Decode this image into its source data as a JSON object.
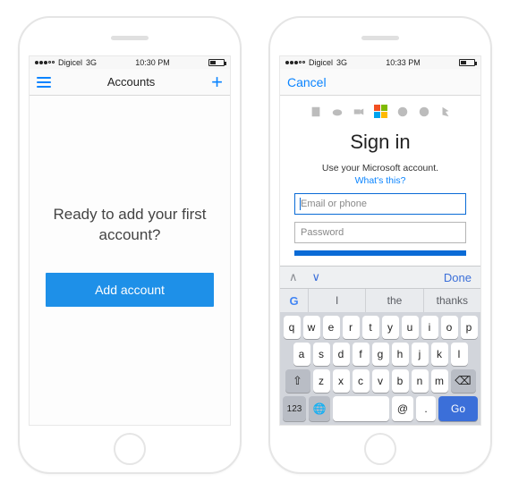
{
  "phone1": {
    "status": {
      "carrier": "Digicel",
      "network": "3G",
      "time": "10:30 PM"
    },
    "nav": {
      "title": "Accounts"
    },
    "body": {
      "prompt": "Ready to add your first account?",
      "add_button": "Add account"
    }
  },
  "phone2": {
    "status": {
      "carrier": "Digicel",
      "network": "3G",
      "time": "10:33 PM"
    },
    "nav": {
      "cancel": "Cancel"
    },
    "signin": {
      "heading": "Sign in",
      "subtext": "Use your Microsoft account.",
      "help_link": "What's this?",
      "email_placeholder": "Email or phone",
      "password_placeholder": "Password"
    },
    "keyboard": {
      "done": "Done",
      "suggestions": [
        "I",
        "the",
        "thanks"
      ],
      "row1": [
        "q",
        "w",
        "e",
        "r",
        "t",
        "y",
        "u",
        "i",
        "o",
        "p"
      ],
      "row2": [
        "a",
        "s",
        "d",
        "f",
        "g",
        "h",
        "j",
        "k",
        "l"
      ],
      "row3": [
        "z",
        "x",
        "c",
        "v",
        "b",
        "n",
        "m"
      ],
      "num_key": "123",
      "at_key": "@",
      "dot_key": ".",
      "go_key": "Go"
    }
  }
}
